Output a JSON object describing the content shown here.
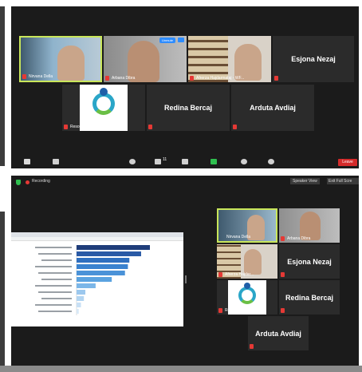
{
  "top_meeting": {
    "tiles": [
      {
        "name": "Nirvana Della",
        "label": "Nirvana Della",
        "type": "video",
        "active": true
      },
      {
        "name": "Arbana Dibra",
        "label": "Arbana Dibra",
        "type": "video",
        "badge": "Unmute"
      },
      {
        "name": "Afrerza Hajdarmataj",
        "label": "Afrerza Hajdarmataj - WF...",
        "type": "video"
      },
      {
        "name": "Esjona Nezaj",
        "label": "Esjona Nezaj",
        "type": "name"
      },
      {
        "name": "Resource Centre",
        "label": "Resource Centre Albania",
        "type": "logo"
      },
      {
        "name": "Redina Bercaj",
        "label": "Redina Bercaj",
        "type": "name"
      },
      {
        "name": "Arduta Avdiaj",
        "label": "Arduta Avdiaj",
        "type": "name"
      }
    ],
    "toolbar": {
      "participants_count": "11",
      "leave_label": "Leave"
    }
  },
  "bottom_meeting": {
    "recording_label": "Recording",
    "speaker_view_label": "Speaker View",
    "exit_fullscreen_label": "Exit Full Scre",
    "tiles": [
      {
        "name": "Nirvana Della",
        "label": "Nirvana Della",
        "type": "video",
        "active": true
      },
      {
        "name": "Arbana Dibra",
        "label": "Arbana Dibra",
        "type": "video"
      },
      {
        "name": "Afrerza Hajdarmataj",
        "label": "Afrerza Hajdar...",
        "type": "video"
      },
      {
        "name": "Esjona Nezaj",
        "label": "Esjona Nezaj",
        "type": "name"
      },
      {
        "name": "Resource Centre",
        "label": "Resource Centre",
        "type": "logo"
      },
      {
        "name": "Redina Bercaj",
        "label": "Redina Bercaj",
        "type": "name"
      },
      {
        "name": "Arduta Avdiaj",
        "label": "Arduta Avdiaj",
        "type": "name"
      }
    ]
  },
  "shared_chart": {
    "type": "bar",
    "values": [
      100,
      88,
      72,
      70,
      66,
      48,
      26,
      12,
      10,
      6,
      3
    ],
    "colors": [
      "#1f3d7a",
      "#2a5aa6",
      "#2f6fbf",
      "#3a82cf",
      "#4a92d8",
      "#5aa2e0",
      "#7bb6e8",
      "#9cc8ee",
      "#b3d5f1",
      "#c8e0f5",
      "#d8e9f7"
    ]
  },
  "colors": {
    "zoom_dark": "#1b1b1b",
    "tile_gray": "#2b2b2b",
    "active_border": "#c9e65a",
    "leave_red": "#d42b2b",
    "mute_red": "#e53935"
  }
}
